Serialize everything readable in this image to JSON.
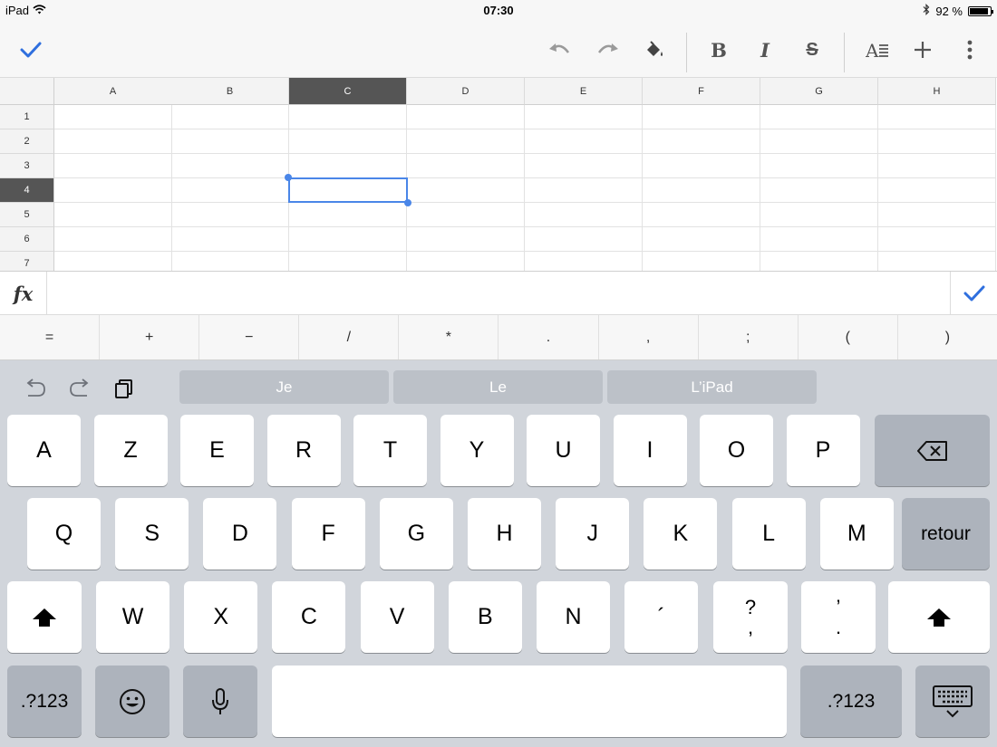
{
  "status_bar": {
    "device": "iPad",
    "time": "07:30",
    "battery": "92 %",
    "battery_level": 0.92
  },
  "toolbar": {
    "confirm_icon": "checkmark-icon",
    "undo_icon": "undo-icon",
    "redo_icon": "redo-icon",
    "fill_icon": "paint-bucket-icon",
    "bold_label": "B",
    "italic_label": "I",
    "strike_label": "S",
    "text_format_icon": "text-format-icon",
    "add_icon": "plus-icon",
    "more_icon": "more-vertical-icon"
  },
  "sheet": {
    "columns": [
      "A",
      "B",
      "C",
      "D",
      "E",
      "F",
      "G",
      "H"
    ],
    "rows": [
      "1",
      "2",
      "3",
      "4",
      "5",
      "6",
      "7"
    ],
    "selected_column": "C",
    "selected_row": "4"
  },
  "formula_bar": {
    "fx_label": "fx",
    "value": "",
    "accent": "#2f6fde"
  },
  "operators": [
    "=",
    "+",
    "−",
    "/",
    "*",
    ".",
    ",",
    ";",
    "(",
    ")"
  ],
  "keyboard": {
    "suggestions": [
      "Je",
      "Le",
      "L’iPad"
    ],
    "row1": [
      "A",
      "Z",
      "E",
      "R",
      "T",
      "Y",
      "U",
      "I",
      "O",
      "P"
    ],
    "row2": [
      "Q",
      "S",
      "D",
      "F",
      "G",
      "H",
      "J",
      "K",
      "L",
      "M"
    ],
    "return_label": "retour",
    "row3": [
      "W",
      "X",
      "C",
      "V",
      "B",
      "N",
      "´"
    ],
    "question_top": "?",
    "question_bottom": ",",
    "apos_top": "’",
    "apos_bottom": ".",
    "numbers_label": ".?123"
  }
}
